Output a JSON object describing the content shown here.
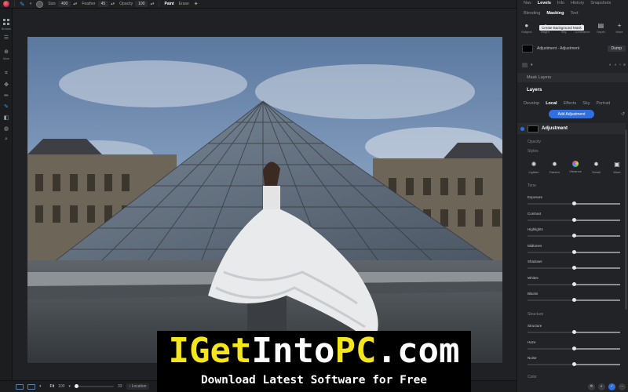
{
  "toolbar": {
    "size_label": "Size",
    "size_value": "400",
    "feather_label": "Feather",
    "feather_value": "45",
    "opacity_label": "Opacity",
    "opacity_value": "100",
    "paint_label": "Paint",
    "erase_label": "Erase"
  },
  "left_tools": {
    "browse_label": "Browse",
    "more_label": "More"
  },
  "right_panel": {
    "top_tabs": [
      "Nav",
      "Levels",
      "Info",
      "History",
      "Snapshots"
    ],
    "top_tabs_active": "Levels",
    "sub_tabs": [
      "Blending",
      "Masking",
      "Text"
    ],
    "sub_tabs_active": "Masking",
    "mask_tools": [
      {
        "label": "Subject",
        "icon": "person-icon"
      },
      {
        "label": "Bright",
        "icon": "brightness-icon"
      },
      {
        "label": "Sky",
        "icon": "sky-icon"
      },
      {
        "label": "Luminance",
        "icon": "luminance-icon"
      },
      {
        "label": "Depth",
        "icon": "depth-icon"
      },
      {
        "label": "More",
        "icon": "plus-icon"
      }
    ],
    "tooltip": "Create Background Mask",
    "mask_name": "Adjustment - Adjustment",
    "dump_label": "Dump",
    "mask_layers_label": "Mask Layers",
    "layers_label": "Layers",
    "layer_tabs": [
      "Develop",
      "Local",
      "Effects",
      "Sky",
      "Portrait"
    ],
    "layer_tabs_active": "Local",
    "add_adjustment_label": "Add Adjustment",
    "adjustment_title": "Adjustment",
    "opacity_label": "Opacity",
    "styles_label": "Styles",
    "styles": [
      {
        "label": "Lighten",
        "icon": "sun-icon"
      },
      {
        "label": "Darken",
        "icon": "darken-icon"
      },
      {
        "label": "Vibrance",
        "icon": "vibrance-icon"
      },
      {
        "label": "Detail",
        "icon": "detail-icon"
      },
      {
        "label": "More",
        "icon": "more-icon"
      }
    ],
    "tone_label": "Tone",
    "tone_sliders": [
      {
        "label": "Exposure",
        "value": 0.5
      },
      {
        "label": "Contrast",
        "value": 0.5
      },
      {
        "label": "Highlights",
        "value": 0.5
      },
      {
        "label": "Midtones",
        "value": 0.5
      },
      {
        "label": "Shadows",
        "value": 0.5
      },
      {
        "label": "Whites",
        "value": 0.5
      },
      {
        "label": "Blacks",
        "value": 0.5
      }
    ],
    "structure_label": "Structure",
    "structure_sliders": [
      {
        "label": "Structure",
        "value": 0.5
      },
      {
        "label": "Haze",
        "value": 0.5
      },
      {
        "label": "Noise",
        "value": 0.5
      }
    ],
    "color_label": "Color"
  },
  "bottom_bar": {
    "fit_label": "Fit",
    "zoom_value": "100",
    "zoom_fraction": 0.05,
    "right_value": "33",
    "location_label": "Location"
  },
  "watermark": {
    "title_yellow_1": "IGet",
    "title_white_1": "Into",
    "title_yellow_2": "PC",
    "title_white_2": ".com",
    "subtitle": "Download Latest Software for Free"
  },
  "colors": {
    "accent": "#2f6fe0",
    "watermark_yellow": "#f5e51c",
    "panel_bg": "#222326"
  }
}
